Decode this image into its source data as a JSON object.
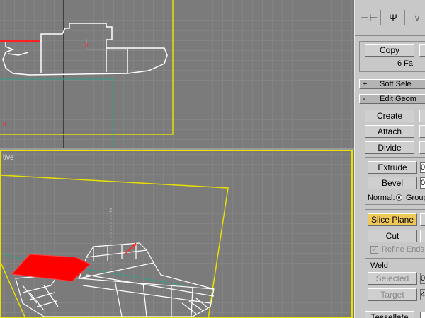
{
  "viewports": {
    "perspective_label": "tive"
  },
  "toolbar": {
    "pin_icon": "pin-icon",
    "modifier_icon": "modifier-stack-icon",
    "more_icon": "chevron-icon"
  },
  "selection": {
    "copy_label": "Copy",
    "faces_text": "6 Fa"
  },
  "rollouts": {
    "soft_selection": {
      "sign": "+",
      "title": "Soft Sele"
    },
    "edit_geometry": {
      "sign": "-",
      "title": "Edit Geom"
    }
  },
  "edit_geometry": {
    "create_label": "Create",
    "attach_label": "Attach",
    "divide_label": "Divide",
    "extrude_label": "Extrude",
    "extrude_value": "0",
    "bevel_label": "Bevel",
    "bevel_value": "0",
    "normal_label": "Normal:",
    "group_label": "Group",
    "slice_plane_label": "Slice Plane",
    "cut_label": "Cut",
    "refine_ends_label": "Refine Ends"
  },
  "weld": {
    "title": "Weld",
    "selected_label": "Selected",
    "selected_value": "0",
    "target_label": "Target",
    "target_value": "4"
  },
  "tessellate_label": "Tessellate"
}
